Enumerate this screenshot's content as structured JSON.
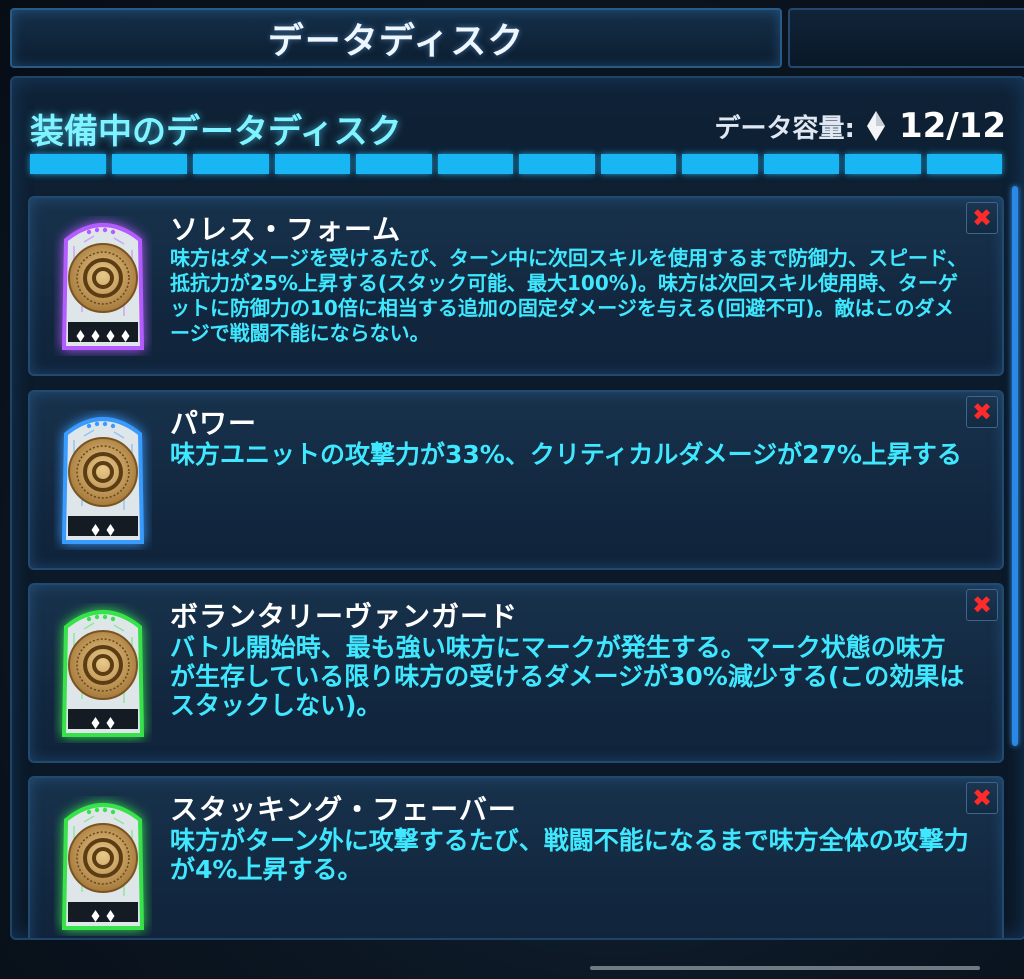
{
  "header": {
    "tab_title": "データディスク"
  },
  "panel": {
    "title": "装備中のデータディスク",
    "capacity_label": "データ容量:",
    "capacity_value": "12/12",
    "capacity_icon": "diamond-icon",
    "capacity_segments_filled": 12,
    "capacity_segments_total": 12
  },
  "disks": [
    {
      "name": "ソレス・フォーム",
      "rarity": "purple",
      "cost": 4,
      "description": "味方はダメージを受けるたび、ターン中に次回スキルを使用するまで防御力、スピード、抵抗力が25%上昇する(スタック可能、最大100%)。味方は次回スキル使用時、ターゲットに防御力の10倍に相当する追加の固定ダメージを与える(回避不可)。敵はこのダメージで戦闘不能にならない。"
    },
    {
      "name": "パワー",
      "rarity": "blue",
      "cost": 2,
      "description": "味方ユニットの攻撃力が33%、クリティカルダメージが27%上昇する"
    },
    {
      "name": "ボランタリーヴァンガード",
      "rarity": "green",
      "cost": 2,
      "description": "バトル開始時、最も強い味方にマークが発生する。マーク状態の味方が生存している限り味方の受けるダメージが30%減少する(この効果はスタックしない)。"
    },
    {
      "name": "スタッキング・フェーバー",
      "rarity": "green",
      "cost": 2,
      "description": "味方がターン外に攻撃するたび、戦闘不能になるまで味方全体の攻撃力が4%上昇する。"
    }
  ],
  "colors": {
    "purple": "#b45cff",
    "blue": "#3a9bff",
    "green": "#38e24a",
    "accent": "#19b6f4",
    "title": "#7ff3ff",
    "desc": "#3fe8ff",
    "close": "#ff2b2b"
  },
  "icons": {
    "close": "close-icon",
    "disk": "data-disk-icon"
  }
}
